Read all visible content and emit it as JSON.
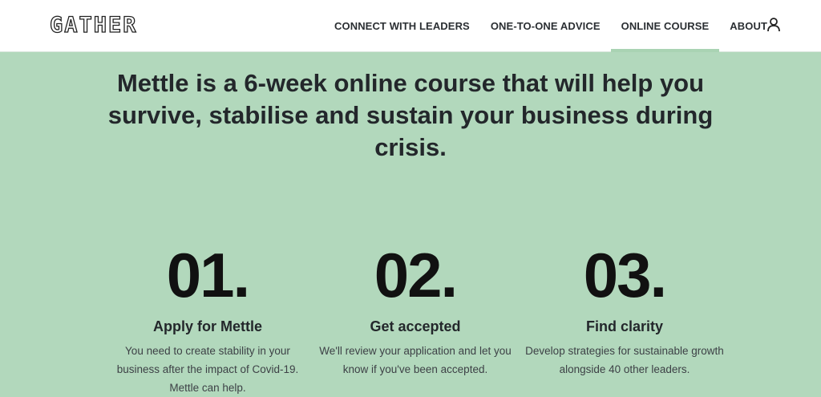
{
  "header": {
    "logo_text": "GATHER",
    "nav": [
      {
        "label": "CONNECT WITH LEADERS"
      },
      {
        "label": "ONE-TO-ONE ADVICE"
      },
      {
        "label": "ONLINE COURSE",
        "active": true
      },
      {
        "label": "ABOUT"
      }
    ],
    "account_icon": "user-icon"
  },
  "hero": {
    "title": "Mettle is a 6-week online course that will help you survive, stabilise and sustain your business during crisis."
  },
  "steps": [
    {
      "number": "01.",
      "title": "Apply for Mettle",
      "description": "You need to create stability in your business after the impact of Covid-19. Mettle can help."
    },
    {
      "number": "02.",
      "title": "Get accepted",
      "description": "We'll review your application and let you know if you've been accepted."
    },
    {
      "number": "03.",
      "title": "Find clarity",
      "description": "Develop strategies for sustainable growth alongside 40 other leaders."
    }
  ],
  "colors": {
    "background": "#b2d8bc",
    "header": "#ffffff",
    "active_underline": "#a9d3b3",
    "text": "#23272b"
  }
}
